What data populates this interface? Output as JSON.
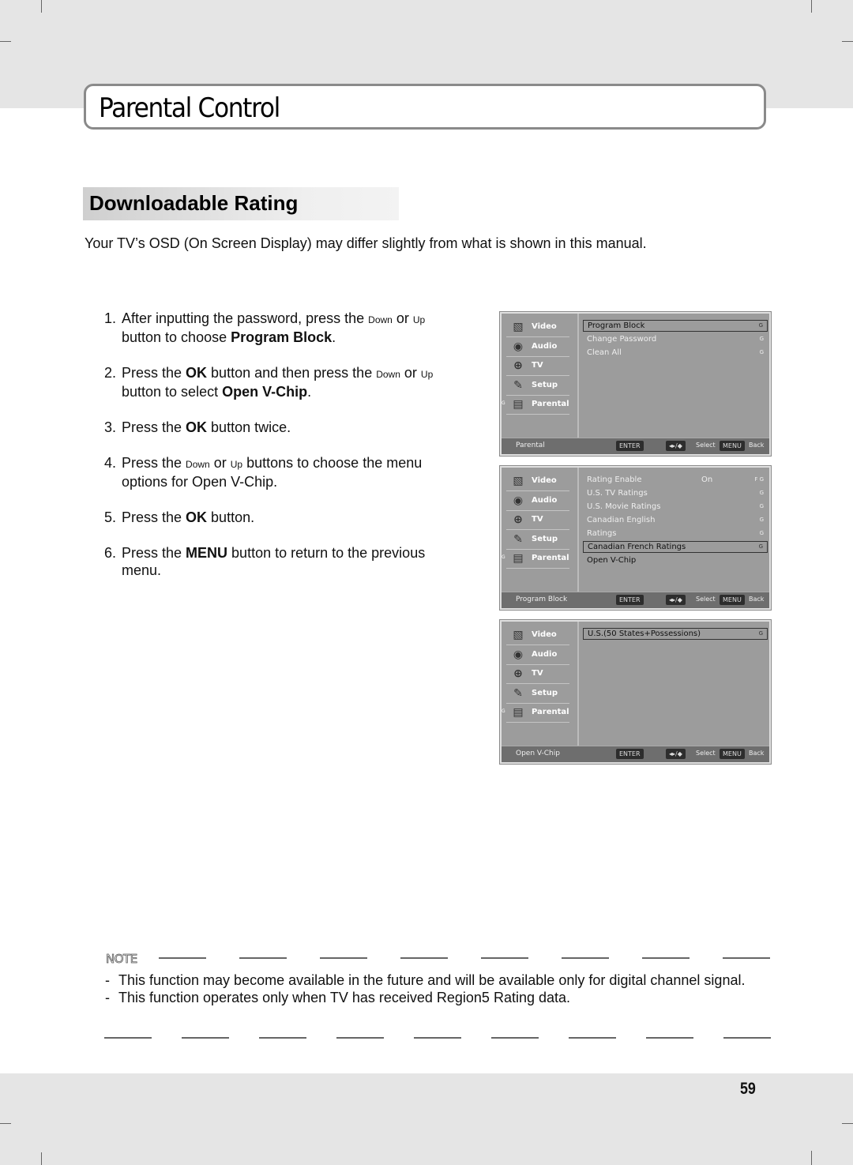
{
  "header": {
    "title": "Parental Control"
  },
  "section": {
    "heading": "Downloadable Rating",
    "intro": "Your TV’s OSD (On Screen Display) may differ slightly from what is shown in this manual."
  },
  "steps": [
    {
      "num": "1.",
      "parts": [
        "After inputting the password, press the ",
        "Down",
        " or ",
        "Up",
        " button to choose ",
        "Program Block",
        "."
      ]
    },
    {
      "num": "2.",
      "parts": [
        "Press the ",
        "OK",
        " button and then press the ",
        "Down",
        " or ",
        "Up",
        " button to select ",
        "Open V-Chip",
        "."
      ]
    },
    {
      "num": "3.",
      "parts": [
        "Press the ",
        "OK",
        " button twice."
      ]
    },
    {
      "num": "4.",
      "parts": [
        "Press the ",
        "Down",
        " or ",
        "Up",
        " buttons to choose the menu options for Open V-Chip."
      ]
    },
    {
      "num": "5.",
      "parts": [
        "Press the ",
        "OK",
        " button."
      ]
    },
    {
      "num": "6.",
      "parts": [
        "Press the ",
        "MENU",
        " button to return to the previous menu."
      ]
    }
  ],
  "osd_sidebar": [
    {
      "label": "Video",
      "icon": "video-icon"
    },
    {
      "label": "Audio",
      "icon": "audio-icon"
    },
    {
      "label": "TV",
      "icon": "tv-icon"
    },
    {
      "label": "Setup",
      "icon": "setup-icon"
    },
    {
      "label": "Parental",
      "icon": "parental-icon",
      "marker": "G"
    }
  ],
  "osd_footer": {
    "enter": "ENTER",
    "nav": "◂▸/◆",
    "select": "Select",
    "menu": "MENU",
    "back": "Back"
  },
  "osd_screens": [
    {
      "crumb": "Parental",
      "items": [
        {
          "label": "Program Block",
          "selected": true,
          "g": "G"
        },
        {
          "label": "Change Password",
          "g": "G"
        },
        {
          "label": "Clean All",
          "g": "G"
        }
      ]
    },
    {
      "crumb": "Program Block",
      "items": [
        {
          "label": "Rating Enable",
          "value": "On",
          "g": "F G"
        },
        {
          "label": "U.S. TV Ratings",
          "g": "G"
        },
        {
          "label": "U.S. Movie Ratings",
          "g": "G"
        },
        {
          "label": "Canadian English",
          "g": "G"
        },
        {
          "label": "Ratings",
          "g": "G"
        },
        {
          "label": "Canadian French Ratings",
          "selected": true,
          "g": "G"
        },
        {
          "label": "Open V-Chip",
          "dark": true
        }
      ]
    },
    {
      "crumb": "Open V-Chip",
      "items": [
        {
          "label": "U.S.(50 States+Possessions)",
          "selected": true,
          "g": "G"
        }
      ]
    }
  ],
  "note": {
    "label": "NOTE",
    "items": [
      "This function may become available in the future and will be available only for digital channel signal.",
      "This function operates only when TV has received Region5 Rating data."
    ]
  },
  "page_number": "59"
}
